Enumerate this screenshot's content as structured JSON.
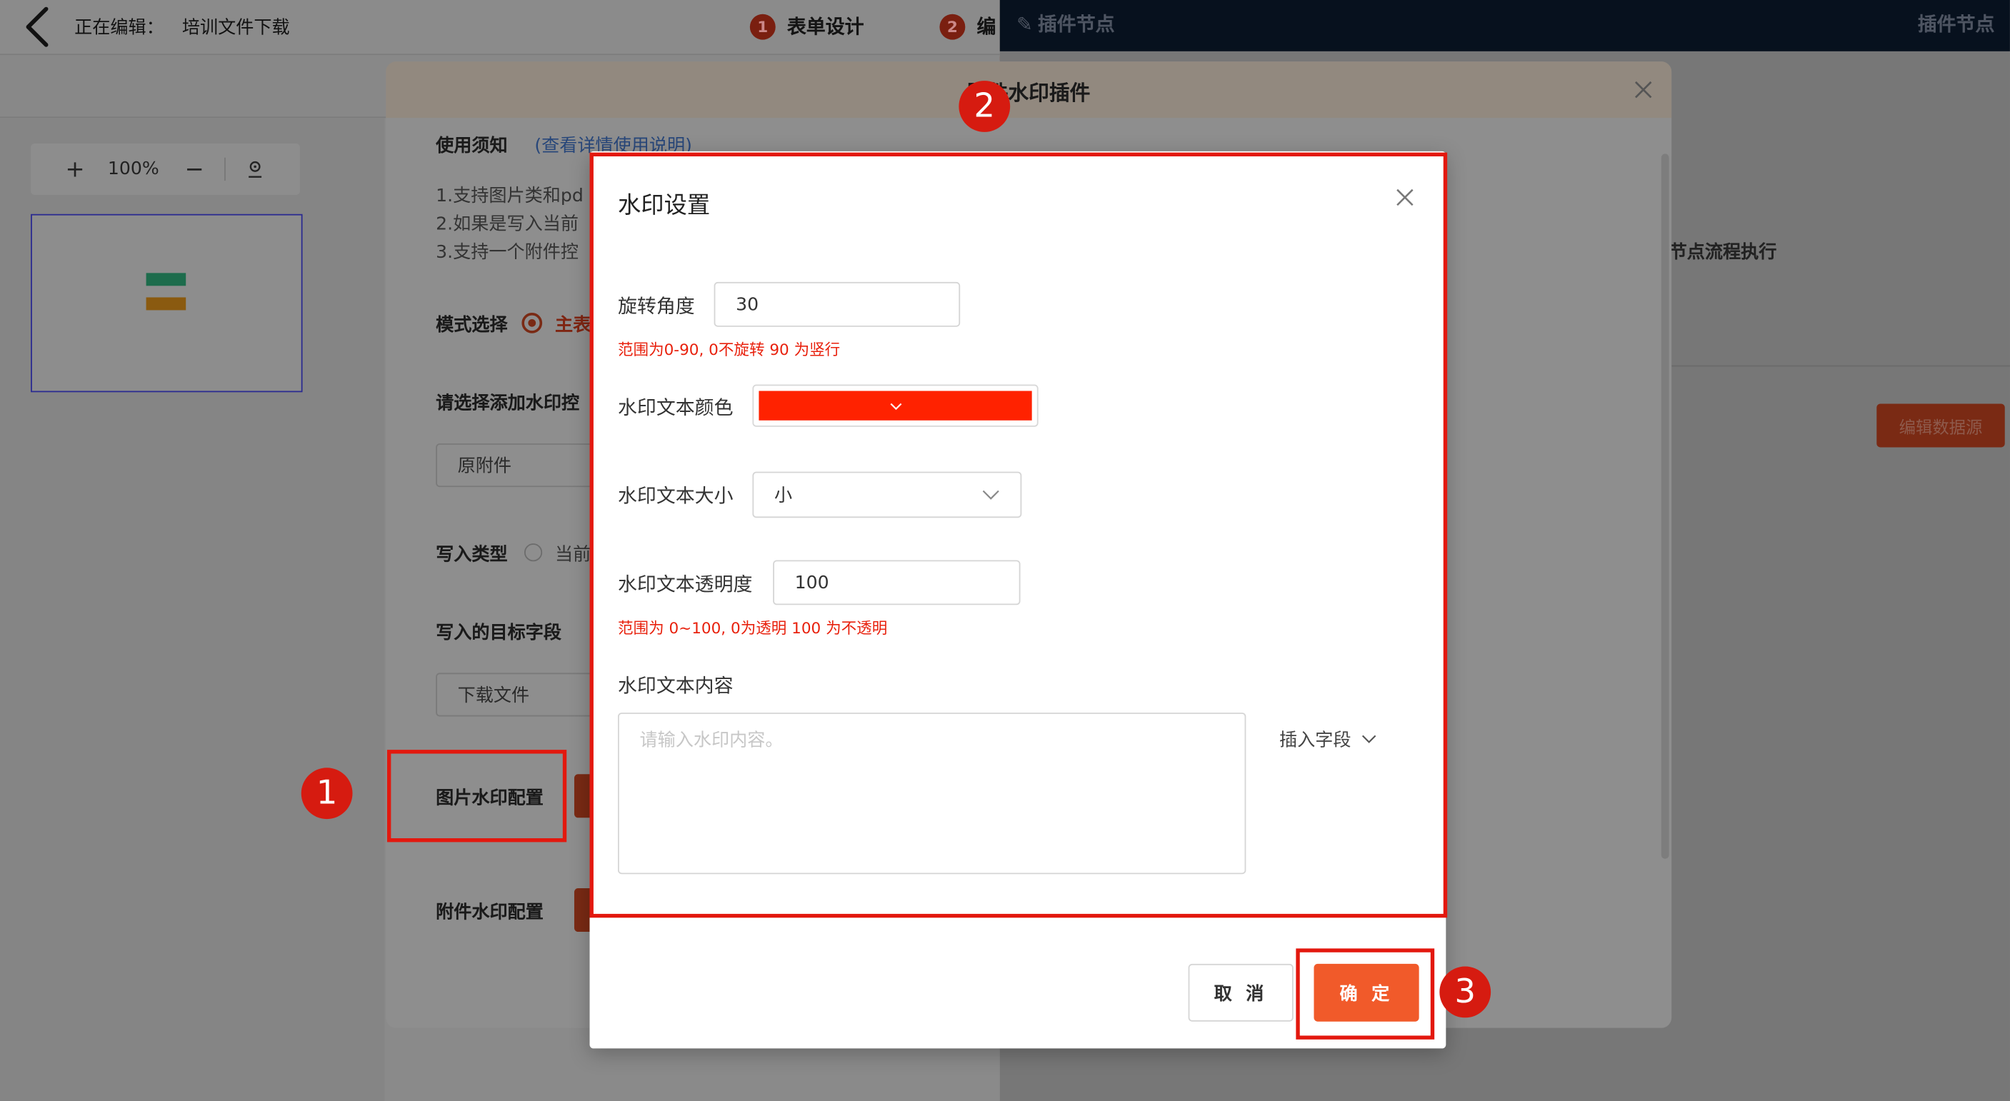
{
  "header": {
    "editing_label": "正在编辑：",
    "document_name": "培训文件下载",
    "steps": [
      {
        "num": "1",
        "label": "表单设计"
      },
      {
        "num": "2",
        "label": "编"
      }
    ]
  },
  "canvas": {
    "zoom": "100%"
  },
  "right_panel": {
    "title": "插件节点",
    "title_right": "插件节点",
    "text": "节点流程执行",
    "edit_datasource_button": "编辑数据源"
  },
  "plugin_modal": {
    "title_visible": "附件水印插件",
    "notice_label": "使用须知",
    "notice_link": "(查看详情使用说明)",
    "notice_lines": [
      "1.支持图片类和pd",
      "2.如果是写入当前",
      "3.支持一个附件控"
    ],
    "mode_label": "模式选择",
    "mode_option": "主表",
    "choose_control_label": "请选择添加水印控",
    "choose_control_value": "原附件",
    "write_type_label": "写入类型",
    "write_type_option": "当前",
    "target_field_label": "写入的目标字段",
    "target_field_value": "下载文件",
    "image_watermark_label": "图片水印配置",
    "attachment_watermark_label": "附件水印配置"
  },
  "watermark_dialog": {
    "title": "水印设置",
    "rotation": {
      "label": "旋转角度",
      "value": "30",
      "hint": "范围为0-90, 0不旋转 90 为竖行"
    },
    "color": {
      "label": "水印文本颜色",
      "value": "#ff2200"
    },
    "size": {
      "label": "水印文本大小",
      "value": "小"
    },
    "opacity": {
      "label": "水印文本透明度",
      "value": "100",
      "hint": "范围为 0~100, 0为透明 100 为不透明"
    },
    "content": {
      "label": "水印文本内容",
      "placeholder": "请输入水印内容。",
      "value": ""
    },
    "insert_field": "插入字段",
    "cancel_button": "取 消",
    "ok_button": "确 定"
  },
  "annotations": {
    "markers": [
      "1",
      "2",
      "3"
    ],
    "highlight_color": "#e3180e"
  }
}
